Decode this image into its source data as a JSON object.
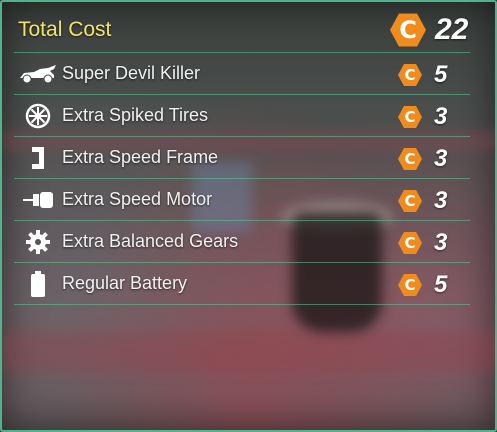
{
  "total": {
    "label": "Total Cost",
    "coin_symbol": "C",
    "value": "22"
  },
  "items": [
    {
      "name": "Super Devil Killer",
      "icon": "car-icon",
      "coin_symbol": "C",
      "cost": "5"
    },
    {
      "name": "Extra Spiked Tires",
      "icon": "tire-icon",
      "coin_symbol": "C",
      "cost": "3"
    },
    {
      "name": "Extra Speed Frame",
      "icon": "frame-icon",
      "coin_symbol": "C",
      "cost": "3"
    },
    {
      "name": "Extra Speed Motor",
      "icon": "motor-icon",
      "coin_symbol": "C",
      "cost": "3"
    },
    {
      "name": "Extra Balanced Gears",
      "icon": "gear-icon",
      "coin_symbol": "C",
      "cost": "3"
    },
    {
      "name": "Regular Battery",
      "icon": "battery-icon",
      "coin_symbol": "C",
      "cost": "5"
    }
  ],
  "colors": {
    "accent_border": "#4fb38c",
    "total_label": "#f2e46a",
    "coin": "#f08b1e"
  }
}
